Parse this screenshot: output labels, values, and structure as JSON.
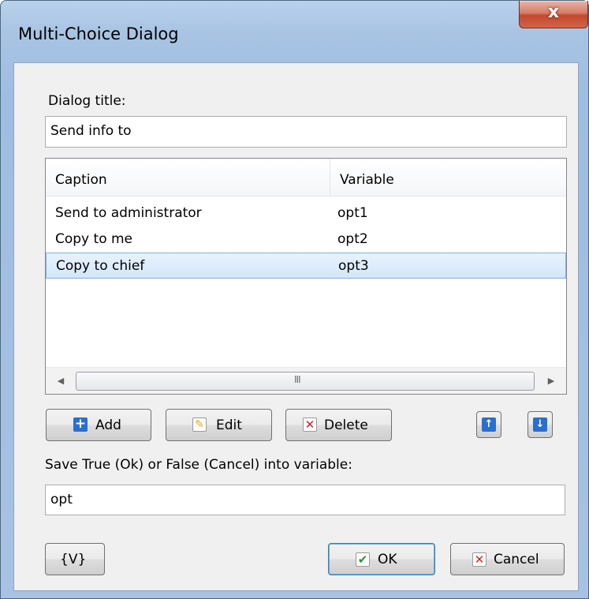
{
  "window": {
    "title": "Multi-Choice Dialog",
    "close_glyph": "x"
  },
  "form": {
    "dialog_title_label": "Dialog title:",
    "dialog_title_value": "Send info to",
    "save_label": "Save True (Ok) or False (Cancel)  into variable:",
    "save_value": "opt"
  },
  "list": {
    "columns": [
      "Caption",
      "Variable"
    ],
    "rows": [
      {
        "caption": "Send to administrator",
        "variable": "opt1"
      },
      {
        "caption": "Copy to me",
        "variable": "opt2"
      },
      {
        "caption": "Copy to chief",
        "variable": "opt3",
        "selected": true
      }
    ],
    "scroll_thumb_grip": "III"
  },
  "buttons": {
    "add": "Add",
    "edit": "Edit",
    "delete": "Delete",
    "variables": "{V}",
    "ok": "OK",
    "cancel": "Cancel"
  },
  "icons": {
    "add": "plus-icon",
    "edit": "pencil-icon",
    "delete": "delete-x-icon",
    "move_up": "arrow-up-icon",
    "move_down": "arrow-down-icon",
    "ok": "checkmark-icon",
    "cancel": "cancel-x-icon"
  },
  "colors": {
    "title_bar": "#a9c4e3",
    "close_button": "#c4472b",
    "selection": "#d4e6fb",
    "accent_icon": "#2a6fcf"
  }
}
